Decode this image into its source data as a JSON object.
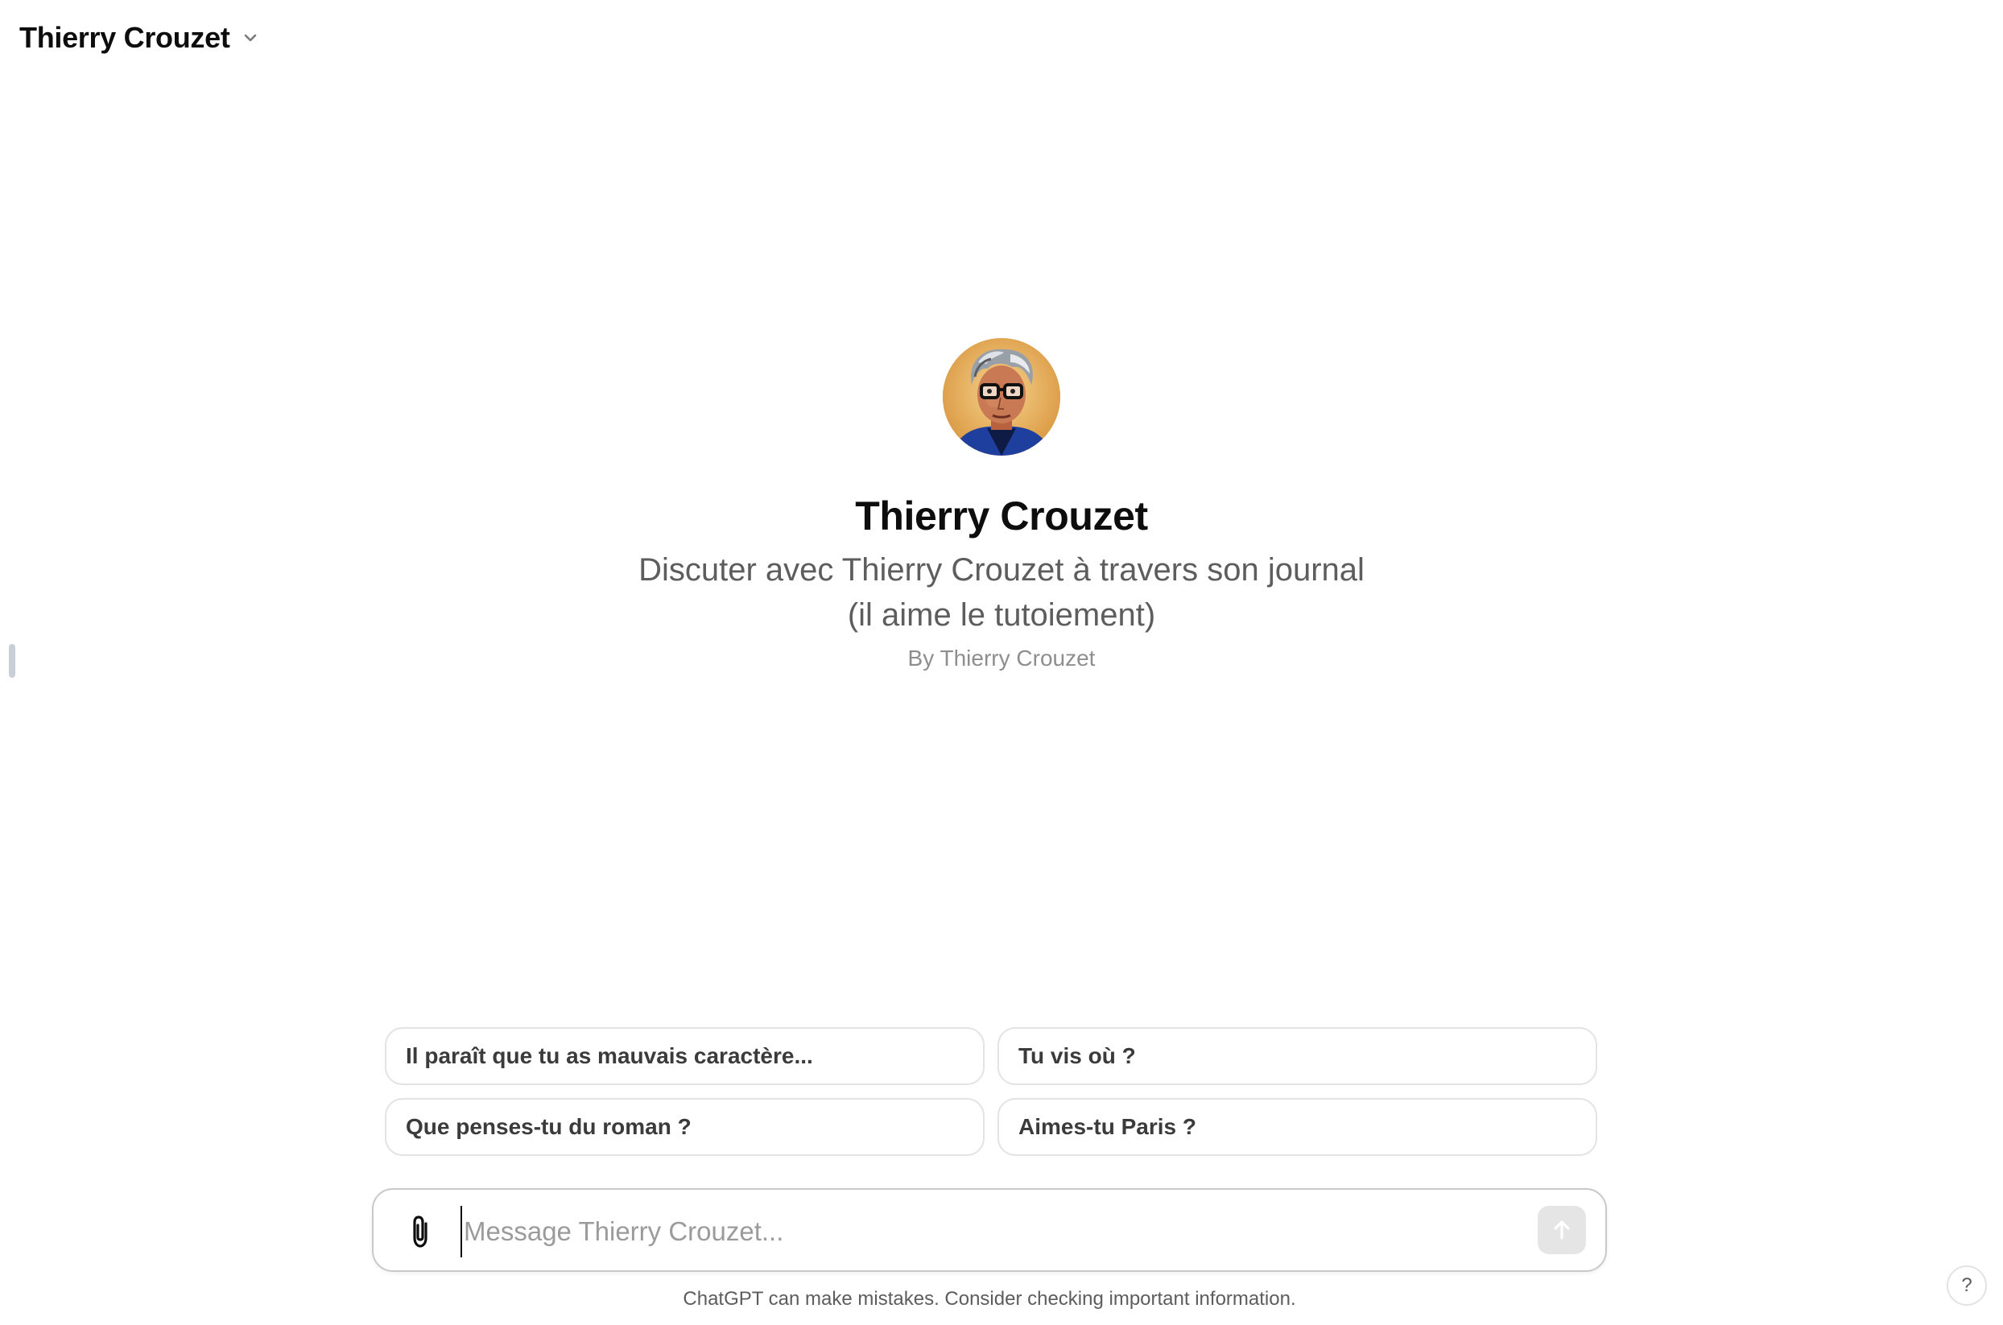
{
  "header": {
    "title": "Thierry Crouzet",
    "dropdown_icon": "chevron-down-icon"
  },
  "hero": {
    "name": "Thierry Crouzet",
    "description_line1": "Discuter avec Thierry Crouzet à travers son journal",
    "description_line2": "(il aime le tutoiement)",
    "author": "By Thierry Crouzet",
    "avatar": "profile-portrait"
  },
  "starters": [
    {
      "label": "Il paraît que tu as mauvais caractère..."
    },
    {
      "label": "Tu vis où ?"
    },
    {
      "label": "Que penses-tu du roman ?"
    },
    {
      "label": "Aimes-tu Paris ?"
    }
  ],
  "composer": {
    "placeholder": "Message Thierry Crouzet...",
    "value": "",
    "attach_icon": "paperclip-icon",
    "send_icon": "arrow-up-icon"
  },
  "footer": {
    "disclaimer": "ChatGPT can make mistakes. Consider checking important information.",
    "help_label": "?"
  },
  "colors": {
    "background": "#ffffff",
    "text_primary": "#0d0d0d",
    "text_secondary": "#5d5d5d",
    "border": "#e3e3e3",
    "send_disabled": "#e5e5e5"
  }
}
